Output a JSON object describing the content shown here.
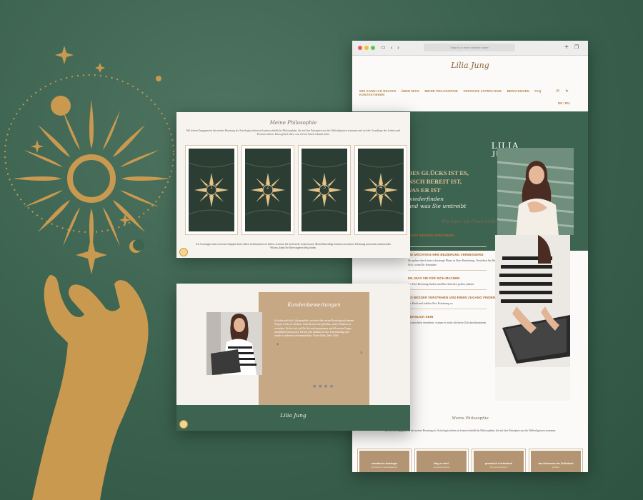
{
  "colors": {
    "green": "#3d6451",
    "gold": "#c9994f",
    "tan": "#c6a885",
    "cream": "#f7f4ef"
  },
  "browser": {
    "address_placeholder": "Search or enter website name",
    "icons": [
      "sidebar-icon",
      "back-icon",
      "forward-icon",
      "plus-icon",
      "tabs-icon"
    ]
  },
  "site": {
    "logo": "Lilia Jung",
    "nav": [
      "WIE KANN ICH HELFEN",
      "ÜBER MICH",
      "MEINE PHILOSOPHIE",
      "VERSICHE ASTROLOGIE",
      "BERATUNGEN",
      "FAQ",
      "KONTAKTIEREN"
    ],
    "language": "DE / RU",
    "hero": {
      "name_line1": "LILIA",
      "name_line2": "JUNG",
      "quote_line1": "DES GLÜCKS IST ES,",
      "quote_line2": "NSCH BEREIT IST,",
      "quote_line3": "VAS ER IST",
      "sub_line1": "wiederfinden",
      "sub_line2": "und was Sie umtreibt"
    },
    "wic_title": "Wie kann ich Ihnen helfen",
    "sections": [
      {
        "heading": "ELBST BESSER VERSTEHEN",
        "text": "wichtigen Themen in Ihrem Leben für Sie haben und wie Sie diese meistern"
      },
      {
        "heading": "SIE MÖCHTEN IHRE BEZIEHUNG VERBESSERN",
        "text": "Sie gehen durch eine schwierige Phase in Ihrer Beziehung. Verstehen Sie Ihre Partnerin und Fragen Sich, wenn Ihr Jemandes"
      },
      {
        "heading": "ER, WAS SIE FÜR SICH MACHEN",
        "text": "Sie Ihre Berufung finden und Ihre Karriere positiv planen"
      },
      {
        "heading": "ND BESSER VERSTEHEN UND EINEN ZUGANG FINDEN",
        "text": "Ihr Kind und wählen Ihre Erziehung so"
      },
      {
        "heading": "LÜHSLICH SEIN",
        "text": "Sie möchten verstehen, warum es nicht die beste Zeit durchkommen"
      }
    ],
    "phil_title": "Meine Philosophie",
    "phil_text": "Mit tiefem Engagement bei meiner Beratung als Astrologin stehen sich unterschiedliche Philosophien, die auf den Prinzipien aus der Weltreligionen stammen.",
    "tiles": [
      {
        "title": "sokratische Astrologie",
        "sub": "im Sinne der Selbsterkenntnis"
      },
      {
        "title": "Weg zu sich?",
        "sub": "persönlicher Reife"
      },
      {
        "title": "persönlich & individuell",
        "sub": "Sie sind nicht gleich"
      },
      {
        "title": "das Geheimnis der Zeitlichkeit",
        "sub": "im Blick"
      }
    ]
  },
  "philosophy_card": {
    "title": "Meine Philosophie",
    "intro": "Mit tiefem Engagement bei meiner Beratung als Astrologin stehen sich unterschiedliche Philosophien, die auf den Prinzipien aus der Weltreligionen stammen und auf der Grundlage des Lebens und Kosmos stehen. Dazu gehört alles, was ich im Leben erkannt habe.",
    "cards": [
      "1",
      "2",
      "3",
      "4"
    ],
    "footer": "Als Astrologin sehe ich meine Aufgabe darin, Ihnen in Situationen zu helfen, in denen Sie nicht mehr weiterwissen. Meine Ratschläge beruhen auf meiner Erfahrung und einem umfassenden Wissen, damit Sie Ihren eigenen Weg finden."
  },
  "testimonial_card": {
    "title": "Kundenbewertungen",
    "text": "Ich habe mich bei Lilia gemeldet, um mehr über meine Berufung und meinen Weg im Leben zu erfahren. Lilia hat mir sehr geholfen, meine Situation zu verstehen. Sie hat sich viel Zeit für mich genommen und alle meine Fragen ausführlich beantwortet. Ich bin sehr dankbar für ihre Unterstützung und würde sie jederzeit weiterempfehlen. Vielen Dank, liebe Lilia!",
    "footer_logo": "Lilia Jung"
  }
}
